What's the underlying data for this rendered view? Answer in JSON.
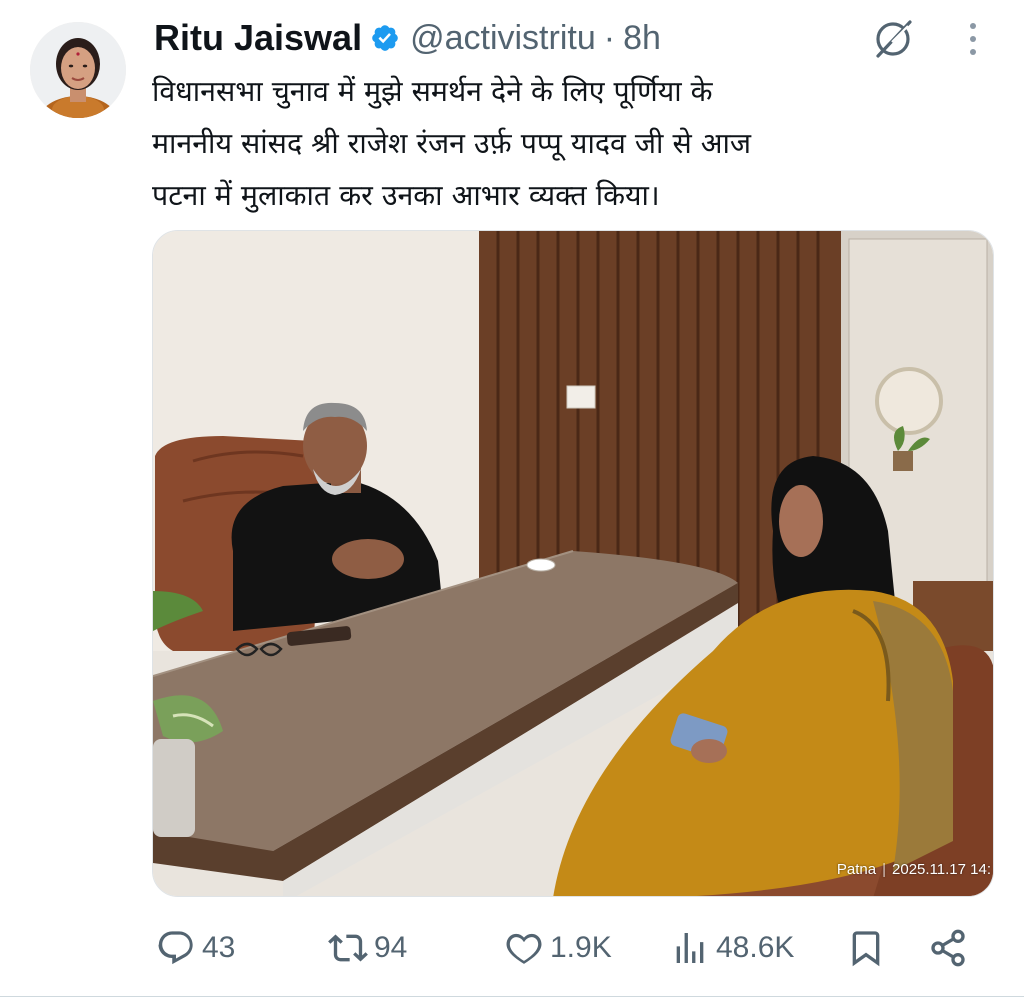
{
  "author": {
    "display_name": "Ritu Jaiswal",
    "handle": "@activistritu",
    "separator": "·",
    "time_ago": "8h",
    "verified": true
  },
  "tweet": {
    "text": "विधानसभा चुनाव में मुझे समर्थन देने के लिए पूर्णिया के\nमाननीय सांसद श्री राजेश रंजन उर्फ़ पप्पू यादव जी से आज\nपटना में मुलाकात कर उनका आभार व्यक्त किया।"
  },
  "media": {
    "stamp_location": "Patna",
    "stamp_separator": "|",
    "stamp_datetime": "2025.11.17 14:"
  },
  "actions": {
    "reply_count": "43",
    "repost_count": "94",
    "like_count": "1.9K",
    "views_count": "48.6K"
  },
  "icons": {
    "verified": "verified-badge-icon",
    "grok": "grok-icon",
    "more": "more-options-icon",
    "reply": "reply-icon",
    "repost": "repost-icon",
    "like": "like-icon",
    "views": "views-icon",
    "bookmark": "bookmark-icon",
    "share": "share-icon"
  },
  "colors": {
    "text_primary": "#0f1419",
    "text_secondary": "#536471",
    "verified_blue": "#1d9bf0"
  }
}
